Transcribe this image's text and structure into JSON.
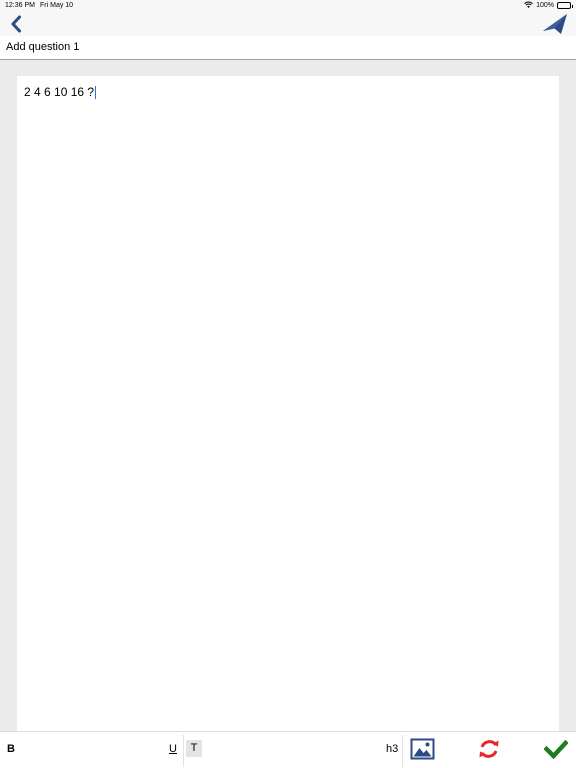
{
  "status_bar": {
    "time": "12:36 PM",
    "date": "Fri May 10",
    "battery": "100%",
    "battery_level": 1.0
  },
  "nav": {
    "back_icon": "chevron-left-icon",
    "send_icon": "paper-plane-icon",
    "accent_color": "#2c4a86"
  },
  "title": "Add question 1",
  "editor": {
    "content": "2 4 6 10 16 ?"
  },
  "toolbar": {
    "bold_label": "B",
    "underline_label": "U",
    "text_label": "T",
    "heading_label": "h3",
    "image_icon": "image-icon",
    "refresh_icon": "refresh-icon",
    "done_icon": "checkmark-icon",
    "refresh_color": "#e8262d",
    "done_color": "#1e7d1e"
  }
}
